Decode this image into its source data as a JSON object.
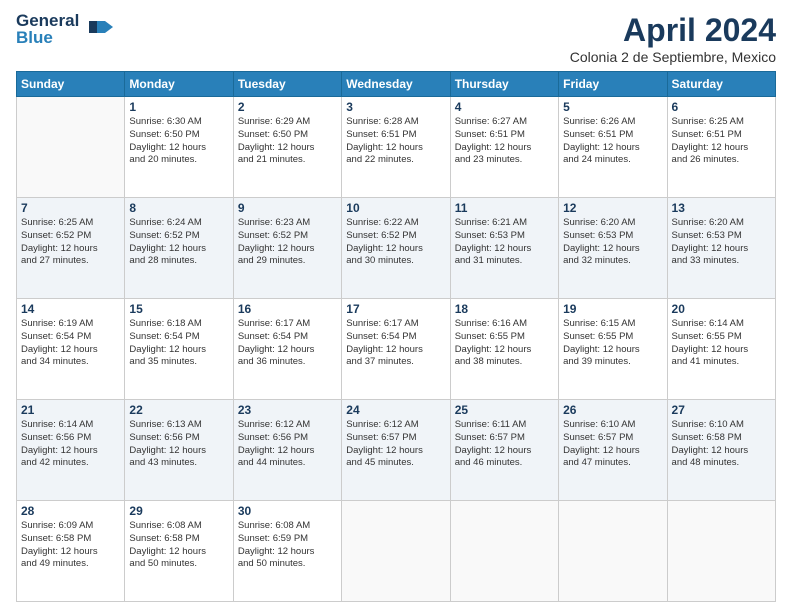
{
  "logo": {
    "line1": "General",
    "line2": "Blue"
  },
  "header": {
    "title": "April 2024",
    "subtitle": "Colonia 2 de Septiembre, Mexico"
  },
  "columns": [
    "Sunday",
    "Monday",
    "Tuesday",
    "Wednesday",
    "Thursday",
    "Friday",
    "Saturday"
  ],
  "weeks": [
    [
      {
        "day": "",
        "info": ""
      },
      {
        "day": "1",
        "info": "Sunrise: 6:30 AM\nSunset: 6:50 PM\nDaylight: 12 hours\nand 20 minutes."
      },
      {
        "day": "2",
        "info": "Sunrise: 6:29 AM\nSunset: 6:50 PM\nDaylight: 12 hours\nand 21 minutes."
      },
      {
        "day": "3",
        "info": "Sunrise: 6:28 AM\nSunset: 6:51 PM\nDaylight: 12 hours\nand 22 minutes."
      },
      {
        "day": "4",
        "info": "Sunrise: 6:27 AM\nSunset: 6:51 PM\nDaylight: 12 hours\nand 23 minutes."
      },
      {
        "day": "5",
        "info": "Sunrise: 6:26 AM\nSunset: 6:51 PM\nDaylight: 12 hours\nand 24 minutes."
      },
      {
        "day": "6",
        "info": "Sunrise: 6:25 AM\nSunset: 6:51 PM\nDaylight: 12 hours\nand 26 minutes."
      }
    ],
    [
      {
        "day": "7",
        "info": "Sunrise: 6:25 AM\nSunset: 6:52 PM\nDaylight: 12 hours\nand 27 minutes."
      },
      {
        "day": "8",
        "info": "Sunrise: 6:24 AM\nSunset: 6:52 PM\nDaylight: 12 hours\nand 28 minutes."
      },
      {
        "day": "9",
        "info": "Sunrise: 6:23 AM\nSunset: 6:52 PM\nDaylight: 12 hours\nand 29 minutes."
      },
      {
        "day": "10",
        "info": "Sunrise: 6:22 AM\nSunset: 6:52 PM\nDaylight: 12 hours\nand 30 minutes."
      },
      {
        "day": "11",
        "info": "Sunrise: 6:21 AM\nSunset: 6:53 PM\nDaylight: 12 hours\nand 31 minutes."
      },
      {
        "day": "12",
        "info": "Sunrise: 6:20 AM\nSunset: 6:53 PM\nDaylight: 12 hours\nand 32 minutes."
      },
      {
        "day": "13",
        "info": "Sunrise: 6:20 AM\nSunset: 6:53 PM\nDaylight: 12 hours\nand 33 minutes."
      }
    ],
    [
      {
        "day": "14",
        "info": "Sunrise: 6:19 AM\nSunset: 6:54 PM\nDaylight: 12 hours\nand 34 minutes."
      },
      {
        "day": "15",
        "info": "Sunrise: 6:18 AM\nSunset: 6:54 PM\nDaylight: 12 hours\nand 35 minutes."
      },
      {
        "day": "16",
        "info": "Sunrise: 6:17 AM\nSunset: 6:54 PM\nDaylight: 12 hours\nand 36 minutes."
      },
      {
        "day": "17",
        "info": "Sunrise: 6:17 AM\nSunset: 6:54 PM\nDaylight: 12 hours\nand 37 minutes."
      },
      {
        "day": "18",
        "info": "Sunrise: 6:16 AM\nSunset: 6:55 PM\nDaylight: 12 hours\nand 38 minutes."
      },
      {
        "day": "19",
        "info": "Sunrise: 6:15 AM\nSunset: 6:55 PM\nDaylight: 12 hours\nand 39 minutes."
      },
      {
        "day": "20",
        "info": "Sunrise: 6:14 AM\nSunset: 6:55 PM\nDaylight: 12 hours\nand 41 minutes."
      }
    ],
    [
      {
        "day": "21",
        "info": "Sunrise: 6:14 AM\nSunset: 6:56 PM\nDaylight: 12 hours\nand 42 minutes."
      },
      {
        "day": "22",
        "info": "Sunrise: 6:13 AM\nSunset: 6:56 PM\nDaylight: 12 hours\nand 43 minutes."
      },
      {
        "day": "23",
        "info": "Sunrise: 6:12 AM\nSunset: 6:56 PM\nDaylight: 12 hours\nand 44 minutes."
      },
      {
        "day": "24",
        "info": "Sunrise: 6:12 AM\nSunset: 6:57 PM\nDaylight: 12 hours\nand 45 minutes."
      },
      {
        "day": "25",
        "info": "Sunrise: 6:11 AM\nSunset: 6:57 PM\nDaylight: 12 hours\nand 46 minutes."
      },
      {
        "day": "26",
        "info": "Sunrise: 6:10 AM\nSunset: 6:57 PM\nDaylight: 12 hours\nand 47 minutes."
      },
      {
        "day": "27",
        "info": "Sunrise: 6:10 AM\nSunset: 6:58 PM\nDaylight: 12 hours\nand 48 minutes."
      }
    ],
    [
      {
        "day": "28",
        "info": "Sunrise: 6:09 AM\nSunset: 6:58 PM\nDaylight: 12 hours\nand 49 minutes."
      },
      {
        "day": "29",
        "info": "Sunrise: 6:08 AM\nSunset: 6:58 PM\nDaylight: 12 hours\nand 50 minutes."
      },
      {
        "day": "30",
        "info": "Sunrise: 6:08 AM\nSunset: 6:59 PM\nDaylight: 12 hours\nand 50 minutes."
      },
      {
        "day": "",
        "info": ""
      },
      {
        "day": "",
        "info": ""
      },
      {
        "day": "",
        "info": ""
      },
      {
        "day": "",
        "info": ""
      }
    ]
  ]
}
